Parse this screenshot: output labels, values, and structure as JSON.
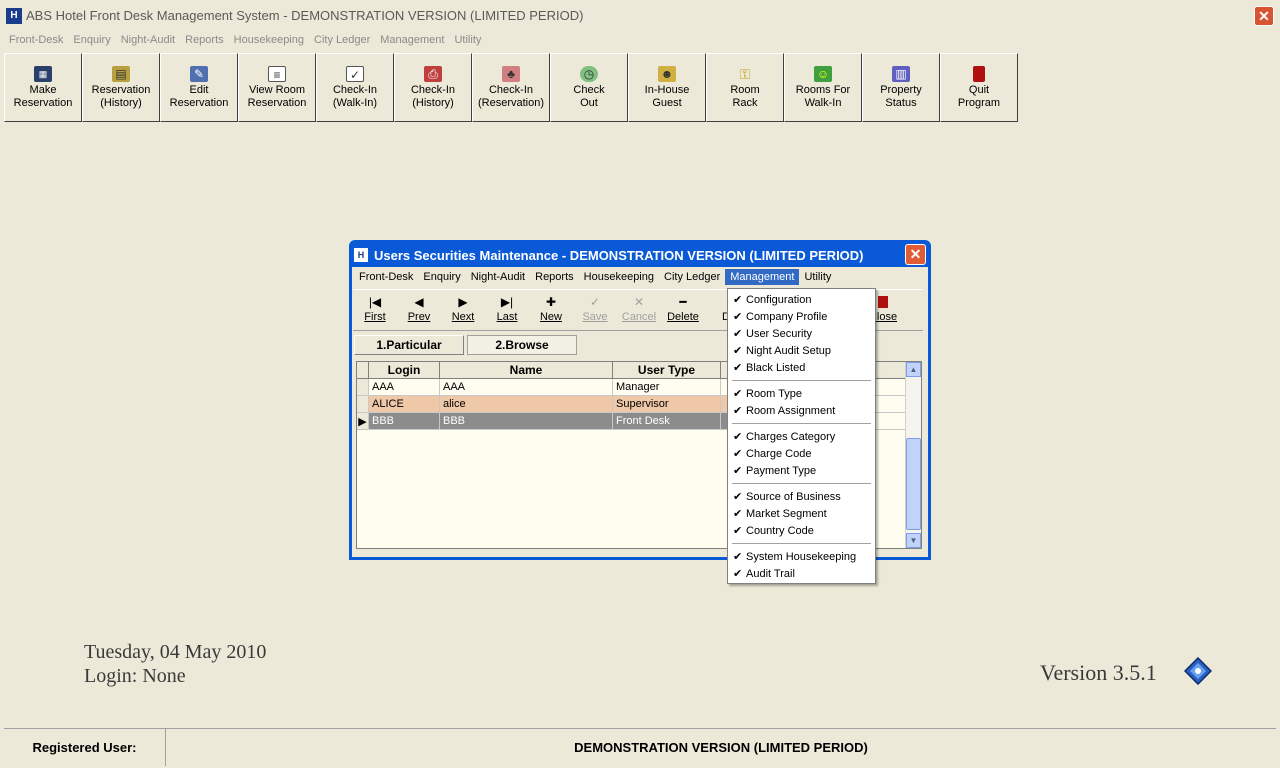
{
  "app": {
    "title": "ABS Hotel Front Desk Management System - DEMONSTRATION VERSION (LIMITED PERIOD)",
    "icon_text": "H"
  },
  "menu": [
    "Front-Desk",
    "Enquiry",
    "Night-Audit",
    "Reports",
    "Housekeeping",
    "City Ledger",
    "Management",
    "Utility"
  ],
  "toolbar": [
    {
      "label": "Make\nReservation",
      "icon": "calendar-icon"
    },
    {
      "label": "Reservation\n(History)",
      "icon": "book-icon"
    },
    {
      "label": "Edit\nReservation",
      "icon": "edit-icon"
    },
    {
      "label": "View Room\nReservation",
      "icon": "document-icon"
    },
    {
      "label": "Check-In\n(Walk-In)",
      "icon": "checklist-icon"
    },
    {
      "label": "Check-In\n(History)",
      "icon": "printer-icon"
    },
    {
      "label": "Check-In\n(Reservation)",
      "icon": "bell-icon"
    },
    {
      "label": "Check\nOut",
      "icon": "clock-icon"
    },
    {
      "label": "In-House\nGuest",
      "icon": "guests-icon"
    },
    {
      "label": "Room\nRack",
      "icon": "key-icon"
    },
    {
      "label": "Rooms For\nWalk-In",
      "icon": "walking-person-icon"
    },
    {
      "label": "Property\nStatus",
      "icon": "buildings-icon"
    },
    {
      "label": "Quit\nProgram",
      "icon": "exit-door-icon"
    }
  ],
  "dialog": {
    "title": "Users Securities Maintenance - DEMONSTRATION VERSION (LIMITED PERIOD)",
    "menu": [
      "Front-Desk",
      "Enquiry",
      "Night-Audit",
      "Reports",
      "Housekeeping",
      "City Ledger",
      "Management",
      "Utility"
    ],
    "active_menu": "Management",
    "nav": [
      {
        "label": "First",
        "glyph": "|◀",
        "enabled": true
      },
      {
        "label": "Prev",
        "glyph": "◀",
        "enabled": true
      },
      {
        "label": "Next",
        "glyph": "▶",
        "enabled": true
      },
      {
        "label": "Last",
        "glyph": "▶|",
        "enabled": true
      },
      {
        "label": "New",
        "glyph": "✚",
        "enabled": true
      },
      {
        "label": "Save",
        "glyph": "✓",
        "enabled": false
      },
      {
        "label": "Cancel",
        "glyph": "✕",
        "enabled": false
      },
      {
        "label": "Delete",
        "glyph": "━",
        "enabled": true
      }
    ],
    "partial_label": "De",
    "close_label": "Close",
    "tabs": [
      "1.Particular",
      "2.Browse"
    ],
    "grid": {
      "headers": [
        "Login",
        "Name",
        "User Type"
      ],
      "rows": [
        [
          "AAA",
          "AAA",
          "Manager"
        ],
        [
          "ALICE",
          "alice",
          "Supervisor"
        ],
        [
          "BBB",
          "BBB",
          "Front Desk"
        ]
      ]
    }
  },
  "dropdown": {
    "groups": [
      [
        "Configuration",
        "Company Profile",
        "User Security",
        "Night Audit Setup",
        "Black Listed"
      ],
      [
        "Room Type",
        "Room Assignment"
      ],
      [
        "Charges Category",
        "Charge Code",
        "Payment Type"
      ],
      [
        "Source of Business",
        "Market Segment",
        "Country Code"
      ],
      [
        "System Housekeeping",
        "Audit Trail"
      ]
    ]
  },
  "footer": {
    "date": "Tuesday, 04 May 2010",
    "login": "Login: None",
    "version": "Version 3.5.1"
  },
  "status": {
    "left": "Registered User:",
    "right": "DEMONSTRATION VERSION (LIMITED PERIOD)"
  }
}
